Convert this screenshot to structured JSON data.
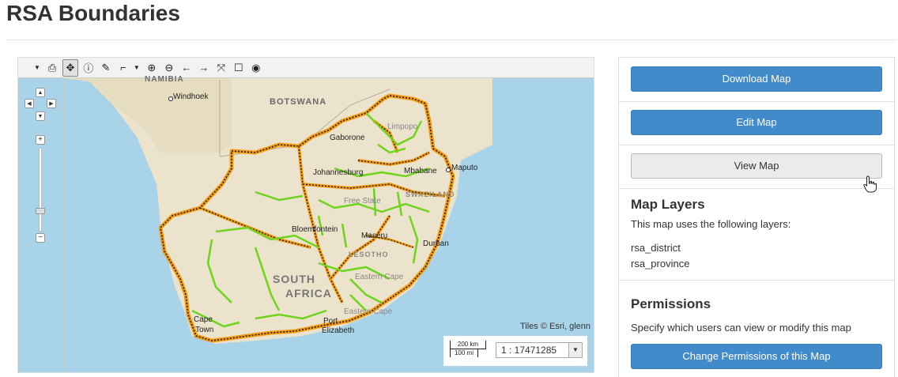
{
  "page": {
    "title": "RSA Boundaries"
  },
  "map": {
    "places": {
      "namibia": "NAMIBIA",
      "windhoek": "Windhoek",
      "botswana": "BOTSWANA",
      "limpopo": "Limpopo",
      "gaborone": "Gaborone",
      "johannesburg": "Johannesburg",
      "mbabane": "Mbabane",
      "maputo": "Maputo",
      "swaziland": "SWAZILAND",
      "free_state": "Free State",
      "bloemfontein": "Bloemfontein",
      "maseru": "Maseru",
      "lesotho": "LESOTHO",
      "durban": "Durban",
      "south": "SOUTH",
      "africa": "AFRICA",
      "eastern_cape_1": "Eastern Cape",
      "eastern_cape_2": "Eastern Cape",
      "cape_town_1": "Cape",
      "cape_town_2": "Town",
      "port_elizabeth_1": "Port",
      "port_elizabeth_2": "Elizabeth"
    },
    "attribution": "Tiles © Esri, glenn",
    "scale": {
      "km": "200 km",
      "mi": "100 mi",
      "ratio": "1 : 17471285"
    },
    "colors": {
      "sea": "#a9d3e8",
      "land": "#ece3cc",
      "province": "#f39c12",
      "district": "#6fd41c"
    }
  },
  "toolbar": {
    "icons": [
      "caret-down-icon",
      "print-icon",
      "pan-icon",
      "info-icon",
      "paint-brush-icon",
      "measure-icon",
      "zoom-in-icon",
      "zoom-out-icon",
      "back-arrow-icon",
      "forward-arrow-icon",
      "fullscreen-icon",
      "calendar-icon",
      "globe-icon"
    ]
  },
  "panel": {
    "download_label": "Download Map",
    "edit_label": "Edit Map",
    "view_label": "View Map",
    "layers_heading": "Map Layers",
    "layers_intro": "This map uses the following layers:",
    "layers": [
      "rsa_district",
      "rsa_province"
    ],
    "permissions_heading": "Permissions",
    "permissions_text": "Specify which users can view or modify this map",
    "permissions_button": "Change Permissions of this Map"
  }
}
